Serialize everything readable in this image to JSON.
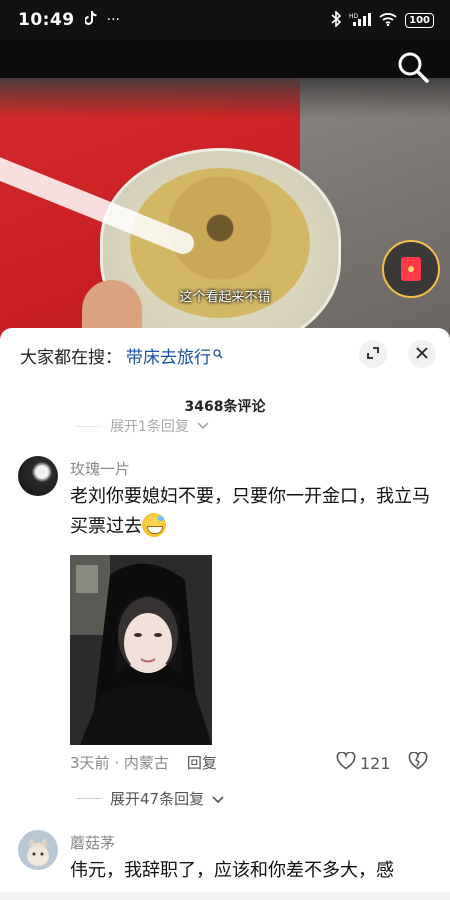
{
  "status_bar": {
    "time": "10:49",
    "dots": "···",
    "battery": "100",
    "icons": [
      "tiktok-icon",
      "bluetooth-icon",
      "hd-signal-icon",
      "wifi-icon",
      "battery-icon"
    ]
  },
  "video": {
    "subtitle": "这个看起来不错"
  },
  "search_suggest": {
    "prefix": "大家都在搜：",
    "query": "带床去旅行",
    "query_icon": "search-small-icon"
  },
  "comments_header": {
    "count_label": "3468条评论"
  },
  "prev_thread": {
    "replies_label": "展开1条回复"
  },
  "comments": [
    {
      "username": "玫瑰一片",
      "text": "老刘你要媳妇不要，只要你一开金口，我立马买票过去",
      "emoji": "grinning-sweat-emoji",
      "time": "3天前",
      "location": "内蒙古",
      "reply_label": "回复",
      "likes": "121",
      "more_replies_label": "展开47条回复"
    },
    {
      "username": "蘑菇茅",
      "text": "伟元，我辞职了，应该和你差不多大，感"
    }
  ],
  "colors": {
    "accent_link": "#1d4fa3",
    "muted_text": "#8a8a8a",
    "red_packet": "#ff3b4a"
  }
}
